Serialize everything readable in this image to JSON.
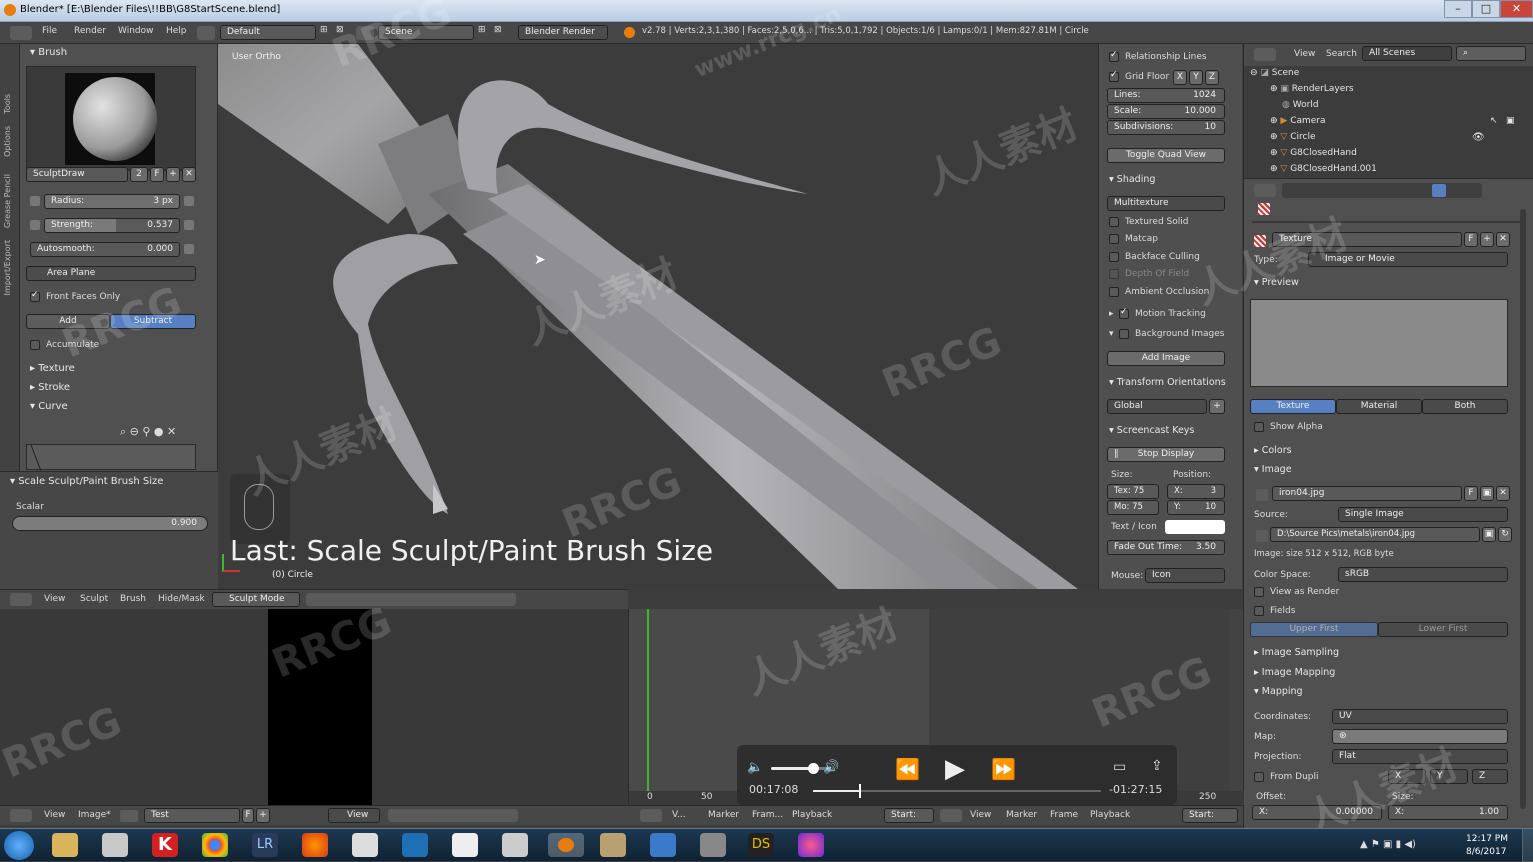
{
  "titlebar": {
    "title": "Blender* [E:\\Blender Files\\!!BB\\G8StartScene.blend]"
  },
  "top_header": {
    "menus": [
      "File",
      "Render",
      "Window",
      "Help"
    ],
    "layout": "Default",
    "scene": "Scene",
    "engine": "Blender Render",
    "stats": "v2.78 | Verts:2,3,1,380 | Faces:2,5,0,6... | Tris:5,0,1,792 | Objects:1/6 | Lamps:0/1 | Mem:827.81M | Circle"
  },
  "tool_tabs": [
    "Tools",
    "Options",
    "Grease Pencil",
    "Import/Export"
  ],
  "tool_shelf": {
    "brush_header": "Brush",
    "brush_name": "SculptDraw",
    "brush_users": "2",
    "brush_fake": "F",
    "radius_label": "Radius:",
    "radius_value": "3 px",
    "strength_label": "Strength:",
    "strength_value": "0.537",
    "autosmooth_label": "Autosmooth:",
    "autosmooth_value": "0.000",
    "area_plane": "Area Plane",
    "front_faces_only": "Front Faces Only",
    "add": "Add",
    "subtract": "Subtract",
    "accumulate": "Accumulate",
    "texture": "Texture",
    "stroke": "Stroke",
    "curve": "Curve",
    "operator_header": "Scale Sculpt/Paint Brush Size",
    "scalar_label": "Scalar",
    "scalar_value": "0.900"
  },
  "viewport": {
    "view_label": "User Ortho",
    "last_op": "Last: Scale Sculpt/Paint Brush Size",
    "object_label": "(0) Circle"
  },
  "n_panel": {
    "relationship_lines": "Relationship Lines",
    "grid_floor": "Grid Floor",
    "axes": [
      "X",
      "Y",
      "Z"
    ],
    "lines_label": "Lines:",
    "lines_value": "1024",
    "scale_label": "Scale:",
    "scale_value": "10.000",
    "subdivisions_label": "Subdivisions:",
    "subdivisions_value": "10",
    "toggle_quad": "Toggle Quad View",
    "shading": "Shading",
    "shading_mode": "Multitexture",
    "textured_solid": "Textured Solid",
    "matcap": "Matcap",
    "backface_culling": "Backface Culling",
    "depth_of_field": "Depth Of Field",
    "ambient_occlusion": "Ambient Occlusion",
    "motion_tracking": "Motion Tracking",
    "background_images": "Background Images",
    "add_image": "Add Image",
    "transform_orientations": "Transform Orientations",
    "orientation": "Global",
    "screencast_keys": "Screencast Keys",
    "stop_display": "Stop Display",
    "size_label": "Size:",
    "position_label": "Position:",
    "tex_value": "Tex: 75",
    "mo_value": "Mo: 75",
    "x_value": "X:",
    "x_num": "3",
    "y_value": "Y:",
    "y_num": "10",
    "text_icon": "Text / Icon",
    "fade_label": "Fade Out Time:",
    "fade_value": "3.50",
    "mouse_label": "Mouse:",
    "mouse_value": "Icon"
  },
  "outliner": {
    "view": "View",
    "search": "Search",
    "filter": "All Scenes",
    "items": [
      "Scene",
      "RenderLayers",
      "World",
      "Camera",
      "Circle",
      "G8ClosedHand",
      "G8ClosedHand.001"
    ]
  },
  "properties": {
    "texture_name": "Texture",
    "texture_fake": "F",
    "type_label": "Type:",
    "type_value": "Image or Movie",
    "preview": "Preview",
    "tabs": [
      "Texture",
      "Material",
      "Both"
    ],
    "show_alpha": "Show Alpha",
    "colors": "Colors",
    "image": "Image",
    "image_name": "iron04.jpg",
    "image_fake": "F",
    "source_label": "Source:",
    "source_value": "Single Image",
    "path": "D:\\Source Pics\\metals\\iron04.jpg",
    "image_info": "Image: size 512 x 512, RGB byte",
    "color_space_label": "Color Space:",
    "color_space_value": "sRGB",
    "view_as_render": "View as Render",
    "fields": "Fields",
    "upper_first": "Upper First",
    "lower_first": "Lower First",
    "image_sampling": "Image Sampling",
    "image_mapping": "Image Mapping",
    "mapping": "Mapping",
    "coordinates_label": "Coordinates:",
    "coordinates_value": "UV",
    "map_label": "Map:",
    "projection_label": "Projection:",
    "projection_value": "Flat",
    "from_dupli": "From Dupli",
    "xyz": [
      "X",
      "Y",
      "Z"
    ],
    "offset_label": "Offset:",
    "size_label": "Size:",
    "offset_x": "X:",
    "offset_x_value": "0.00000",
    "size_x": "X:",
    "size_x_value": "1.00"
  },
  "viewport_header": {
    "menus": [
      "View",
      "Sculpt",
      "Brush",
      "Hide/Mask"
    ],
    "mode": "Sculpt Mode"
  },
  "bottom_header": {
    "image_menus": [
      "View",
      "Image*"
    ],
    "image_name": "Test",
    "image_fake": "F",
    "view_menu": "View",
    "timeline_menus": [
      "View",
      "Marker",
      "Frame",
      "Playback"
    ],
    "timeline_menus_left": [
      "V...",
      "Marker",
      "Fram...",
      "Playback"
    ],
    "start_label": "Start:",
    "start_label2": "Start:"
  },
  "timeline": {
    "ticks": [
      "0",
      "50",
      "250"
    ]
  },
  "player": {
    "elapsed": "00:17:08",
    "remaining": "-01:27:15",
    "volume": 0.75,
    "progress": 0.16
  },
  "taskbar": {
    "time": "12:17 PM",
    "date": "8/6/2017"
  },
  "watermarks": [
    "RRCG",
    "人人素材",
    "RRCG",
    "人人素材",
    "RRCG",
    "人人素材",
    "RRCG",
    "人人素材",
    "RRCG",
    "人人素材",
    "RRCG",
    "人人素材",
    "RRCG",
    "www.rrcg.cn"
  ],
  "colors": {
    "accent_blue": "#5680c2",
    "grid_green": "#3eb82f"
  }
}
